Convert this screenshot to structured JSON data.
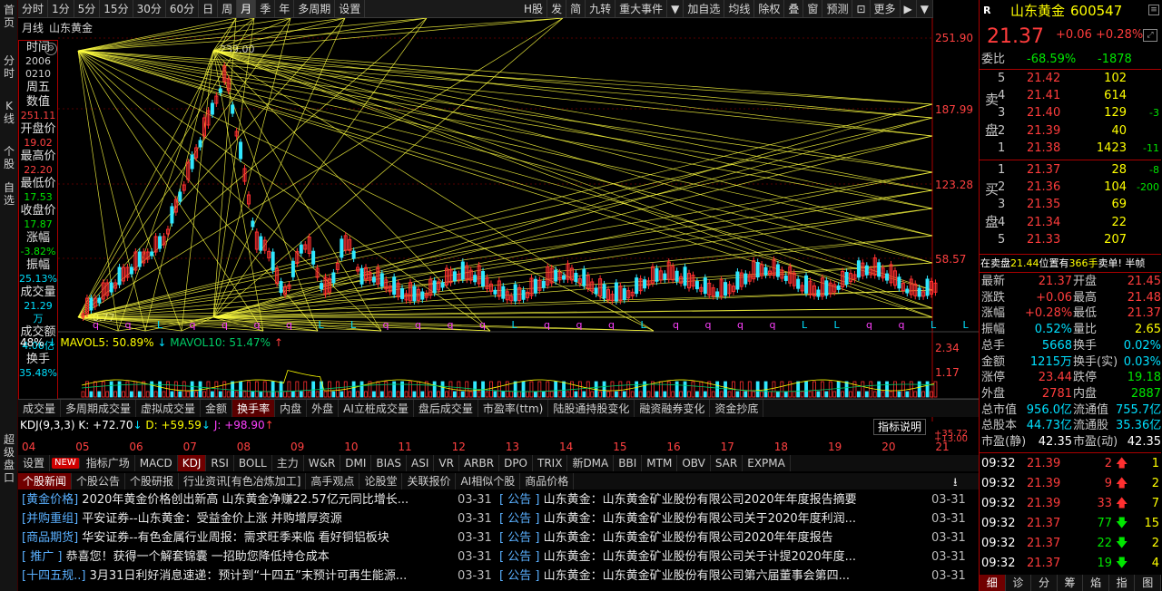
{
  "left_strip": {
    "labels": [
      "首页",
      "分时",
      "K线",
      "个股",
      "自选",
      "超级盘口"
    ]
  },
  "toolbar": {
    "periods": [
      "分时",
      "1分",
      "5分",
      "15分",
      "30分",
      "60分",
      "日",
      "周",
      "月",
      "季",
      "年",
      "多周期",
      "设置"
    ],
    "active_period": "月",
    "tools": [
      "H股",
      "发",
      "简",
      "九转",
      "重大事件",
      "▼",
      "加自选",
      "均线",
      "除权",
      "叠",
      "窗",
      "预测",
      "⊡",
      "更多",
      "▶",
      "▼"
    ]
  },
  "chart": {
    "period_label": "月线",
    "stock_label": "山东黄金",
    "price_axis": [
      "251.90",
      "187.99",
      "123.28",
      "58.57"
    ],
    "high_mark": "239.00",
    "low_mark": "0.77",
    "vol_axis": [
      "2.34",
      "1.17"
    ],
    "markers": [
      "q",
      "q",
      "L",
      "q",
      "q",
      "q",
      "q",
      "L",
      "L",
      "q",
      "q",
      "q",
      "q",
      "L",
      "q",
      "q",
      "q",
      "L",
      "q",
      "q",
      "q",
      "q",
      "L",
      "L",
      "q",
      "q",
      "L",
      "L"
    ],
    "vol_legend": {
      "a": "48%",
      "b": "MAVOL5: 50.89%",
      "c": "MAVOL10: 51.47%"
    },
    "kdj_legend": {
      "name": "KDJ(9,3,3)",
      "k": "K: +72.70",
      "d": "D: +59.59",
      "j": "J: +98.90",
      "right_a": "+35.72",
      "right_b": "+13.00"
    },
    "kdj_btn": "指标说明",
    "x_labels": [
      "04",
      "05",
      "06",
      "07",
      "08",
      "09",
      "10",
      "11",
      "12",
      "13",
      "14",
      "15",
      "16",
      "17",
      "18",
      "19",
      "20",
      "21"
    ],
    "colors": {
      "up": "#ff3030",
      "down": "#30e8ff",
      "fan": "#ffff40",
      "bg": "#000000",
      "axis": "#aa0000"
    }
  },
  "info_panel": [
    {
      "label": "时间",
      "value": "2006"
    },
    {
      "label": "",
      "value": "0210"
    },
    {
      "label": "周五",
      "value": ""
    },
    {
      "label": "数值",
      "value": "251.11"
    },
    {
      "label": "开盘价",
      "value": "19.02"
    },
    {
      "label": "最高价",
      "value": "22.20"
    },
    {
      "label": "最低价",
      "value": "17.53"
    },
    {
      "label": "收盘价",
      "value": "17.87"
    },
    {
      "label": "涨幅",
      "value": "-3.82%"
    },
    {
      "label": "振幅",
      "value": "25.13%"
    },
    {
      "label": "成交量",
      "value": "21.29万"
    },
    {
      "label": "成交额",
      "value": "4.06亿"
    },
    {
      "label": "换手",
      "value": "35.48%"
    }
  ],
  "bottom_tabs": {
    "items": [
      "成交量",
      "多周期成交量",
      "虚拟成交量",
      "金额",
      "换手率",
      "内盘",
      "外盘",
      "AI立桩成交量",
      "盘后成交量",
      "市盈率(ttm)",
      "陆股通持股变化",
      "融资融券变化",
      "资金抄底"
    ],
    "active": "换手率"
  },
  "indicator_tabs": {
    "items": [
      "设置",
      "NEW",
      "指标广场",
      "MACD",
      "KDJ",
      "RSI",
      "BOLL",
      "主力",
      "W&R",
      "DMI",
      "BIAS",
      "ASI",
      "VR",
      "ARBR",
      "DPO",
      "TRIX",
      "新DMA",
      "BBI",
      "MTM",
      "OBV",
      "SAR",
      "EXPMA"
    ],
    "active": "KDJ"
  },
  "news_tabs": {
    "items": [
      "个股新闻",
      "个股公告",
      "个股研报",
      "行业资讯[有色冶炼加工]",
      "高手观点",
      "论股堂",
      "关联报价",
      "AI相似个股",
      "商品价格"
    ],
    "active": "个股新闻"
  },
  "news": [
    {
      "tag": "[黄金价格]",
      "title": "2020年黄金价格创出新高 山东黄金净赚22.57亿元同比增长...",
      "date": "03-31"
    },
    {
      "tag": "[并购重组]",
      "title": "平安证券--山东黄金：受益金价上涨 并购增厚资源",
      "date": "03-31"
    },
    {
      "tag": "[商品期货]",
      "title": "华安证券--有色金属行业周报：需求旺季来临 看好铜铝板块",
      "date": "03-31"
    },
    {
      "tag": "[ 推广 ]",
      "title": "恭喜您！获得一个解套锦囊 一招助您降低持仓成本",
      "date": "03-31"
    },
    {
      "tag": "[十四五规..]",
      "title": "3月31日利好消息速递：预计到“十四五”末预计可再生能源...",
      "date": "03-31"
    }
  ],
  "notices": [
    {
      "tag": "[ 公告 ]",
      "title": "山东黄金：山东黄金矿业股份有限公司2020年年度报告摘要",
      "date": "03-31"
    },
    {
      "tag": "[ 公告 ]",
      "title": "山东黄金：山东黄金矿业股份有限公司关于2020年度利润...",
      "date": "03-31"
    },
    {
      "tag": "[ 公告 ]",
      "title": "山东黄金：山东黄金矿业股份有限公司2020年年度报告",
      "date": "03-31"
    },
    {
      "tag": "[ 公告 ]",
      "title": "山东黄金：山东黄金矿业股份有限公司关于计提2020年度...",
      "date": "03-31"
    },
    {
      "tag": "[ 公告 ]",
      "title": "山东黄金：山东黄金矿业股份有限公司第六届董事会第四...",
      "date": "03-31"
    }
  ],
  "quote": {
    "flag": "R",
    "name": "山东黄金",
    "code": "600547",
    "price": "21.37",
    "change": "+0.06",
    "pct": "+0.28%",
    "weibi_label": "委比",
    "weibi": "-68.59%",
    "weicha": "-1878",
    "sell_label": [
      "卖",
      "盘"
    ],
    "buy_label": [
      "买",
      "盘"
    ],
    "sells": [
      {
        "n": "5",
        "p": "21.42",
        "v": "102",
        "c": ""
      },
      {
        "n": "4",
        "p": "21.41",
        "v": "614",
        "c": ""
      },
      {
        "n": "3",
        "p": "21.40",
        "v": "129",
        "c": "-3"
      },
      {
        "n": "2",
        "p": "21.39",
        "v": "40",
        "c": ""
      },
      {
        "n": "1",
        "p": "21.38",
        "v": "1423",
        "c": "-11"
      }
    ],
    "buys": [
      {
        "n": "1",
        "p": "21.37",
        "v": "28",
        "c": "-8"
      },
      {
        "n": "2",
        "p": "21.36",
        "v": "104",
        "c": "-200"
      },
      {
        "n": "3",
        "p": "21.35",
        "v": "69",
        "c": ""
      },
      {
        "n": "4",
        "p": "21.34",
        "v": "22",
        "c": ""
      },
      {
        "n": "5",
        "p": "21.33",
        "v": "207",
        "c": ""
      }
    ],
    "order_note": {
      "a": "在卖盘",
      "b": "21.44",
      "c": "位置有",
      "d": "366手",
      "e": "卖单! 半帧"
    },
    "stats": [
      [
        "最新",
        "21.37",
        "开盘",
        "21.45"
      ],
      [
        "涨跌",
        "+0.06",
        "最高",
        "21.48"
      ],
      [
        "涨幅",
        "+0.28%",
        "最低",
        "21.37"
      ],
      [
        "振幅",
        "0.52%",
        "量比",
        "2.65"
      ],
      [
        "总手",
        "5668",
        "换手",
        "0.02%"
      ],
      [
        "金额",
        "1215万",
        "换手(实)",
        "0.03%"
      ],
      [
        "涨停",
        "23.44",
        "跌停",
        "19.18"
      ],
      [
        "外盘",
        "2781",
        "内盘",
        "2887"
      ],
      [
        "总市值",
        "956.0亿",
        "流通值",
        "755.7亿"
      ],
      [
        "总股本",
        "44.73亿",
        "流通股",
        "35.36亿"
      ],
      [
        "市盈(静)",
        "42.35",
        "市盈(动)",
        "42.35"
      ]
    ],
    "ticks": [
      {
        "t": "09:32",
        "p": "21.39",
        "v": "2",
        "dir": "up",
        "n": "1"
      },
      {
        "t": "09:32",
        "p": "21.39",
        "v": "9",
        "dir": "up",
        "n": "2"
      },
      {
        "t": "09:32",
        "p": "21.39",
        "v": "33",
        "dir": "up",
        "n": "7"
      },
      {
        "t": "09:32",
        "p": "21.37",
        "v": "77",
        "dir": "down",
        "n": "15"
      },
      {
        "t": "09:32",
        "p": "21.37",
        "v": "22",
        "dir": "down",
        "n": "2"
      },
      {
        "t": "09:32",
        "p": "21.37",
        "v": "19",
        "dir": "down",
        "n": "4"
      }
    ],
    "footer_tabs": [
      "细",
      "诊",
      "分",
      "筹",
      "焰",
      "指",
      "图"
    ]
  }
}
